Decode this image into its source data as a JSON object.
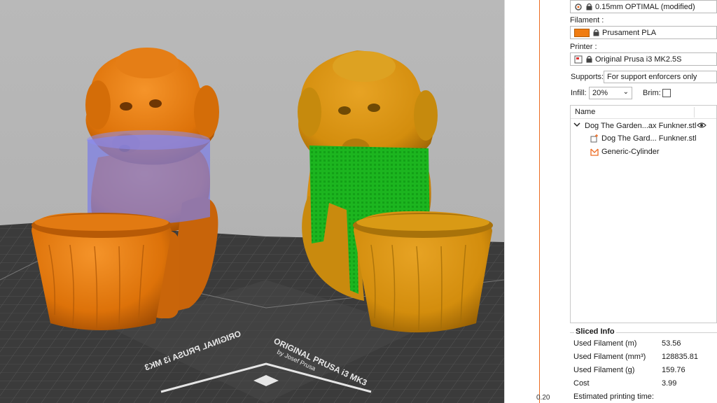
{
  "sidebar": {
    "print_profile": "0.15mm OPTIMAL (modified)",
    "filament_label": "Filament :",
    "filament_value": "Prusament PLA",
    "filament_color": "#f07c12",
    "printer_label": "Printer :",
    "printer_value": "Original Prusa i3 MK2.5S",
    "supports_label": "Supports:",
    "supports_value": "For support enforcers only",
    "infill_label": "Infill:",
    "infill_value": "20%",
    "brim_label": "Brim:",
    "brim_checked": false
  },
  "object_list": {
    "header": "Name",
    "object_name": "Dog The Garden...ax Funkner.stl",
    "part_name": "Dog The Gard... Funkner.stl",
    "modifier_name": "Generic-Cylinder"
  },
  "sliced_info": {
    "title": "Sliced Info",
    "rows": [
      {
        "label": "Used Filament (m)",
        "value": "53.56"
      },
      {
        "label": "Used Filament (mm³)",
        "value": "128835.81"
      },
      {
        "label": "Used Filament (g)",
        "value": "159.76"
      },
      {
        "label": "Cost",
        "value": "3.99"
      },
      {
        "label": "Estimated printing time:",
        "value": ""
      }
    ]
  },
  "layer_slider": {
    "value": "0.20"
  },
  "bed": {
    "label_main": "ORIGINAL PRUSA i3 MK3",
    "label_sub": "by Josef Prusa",
    "label_main_mirror": "ORIGINAL PRUSA i3 MK3",
    "label_sub_mirror": "by Josef Prusa"
  },
  "colors": {
    "accent": "#ed6b21",
    "model_orange": "#e47a10",
    "model_sliced": "#d9930e",
    "support_green": "#18b21c",
    "enforcer_blue": "#7d7ee6"
  }
}
